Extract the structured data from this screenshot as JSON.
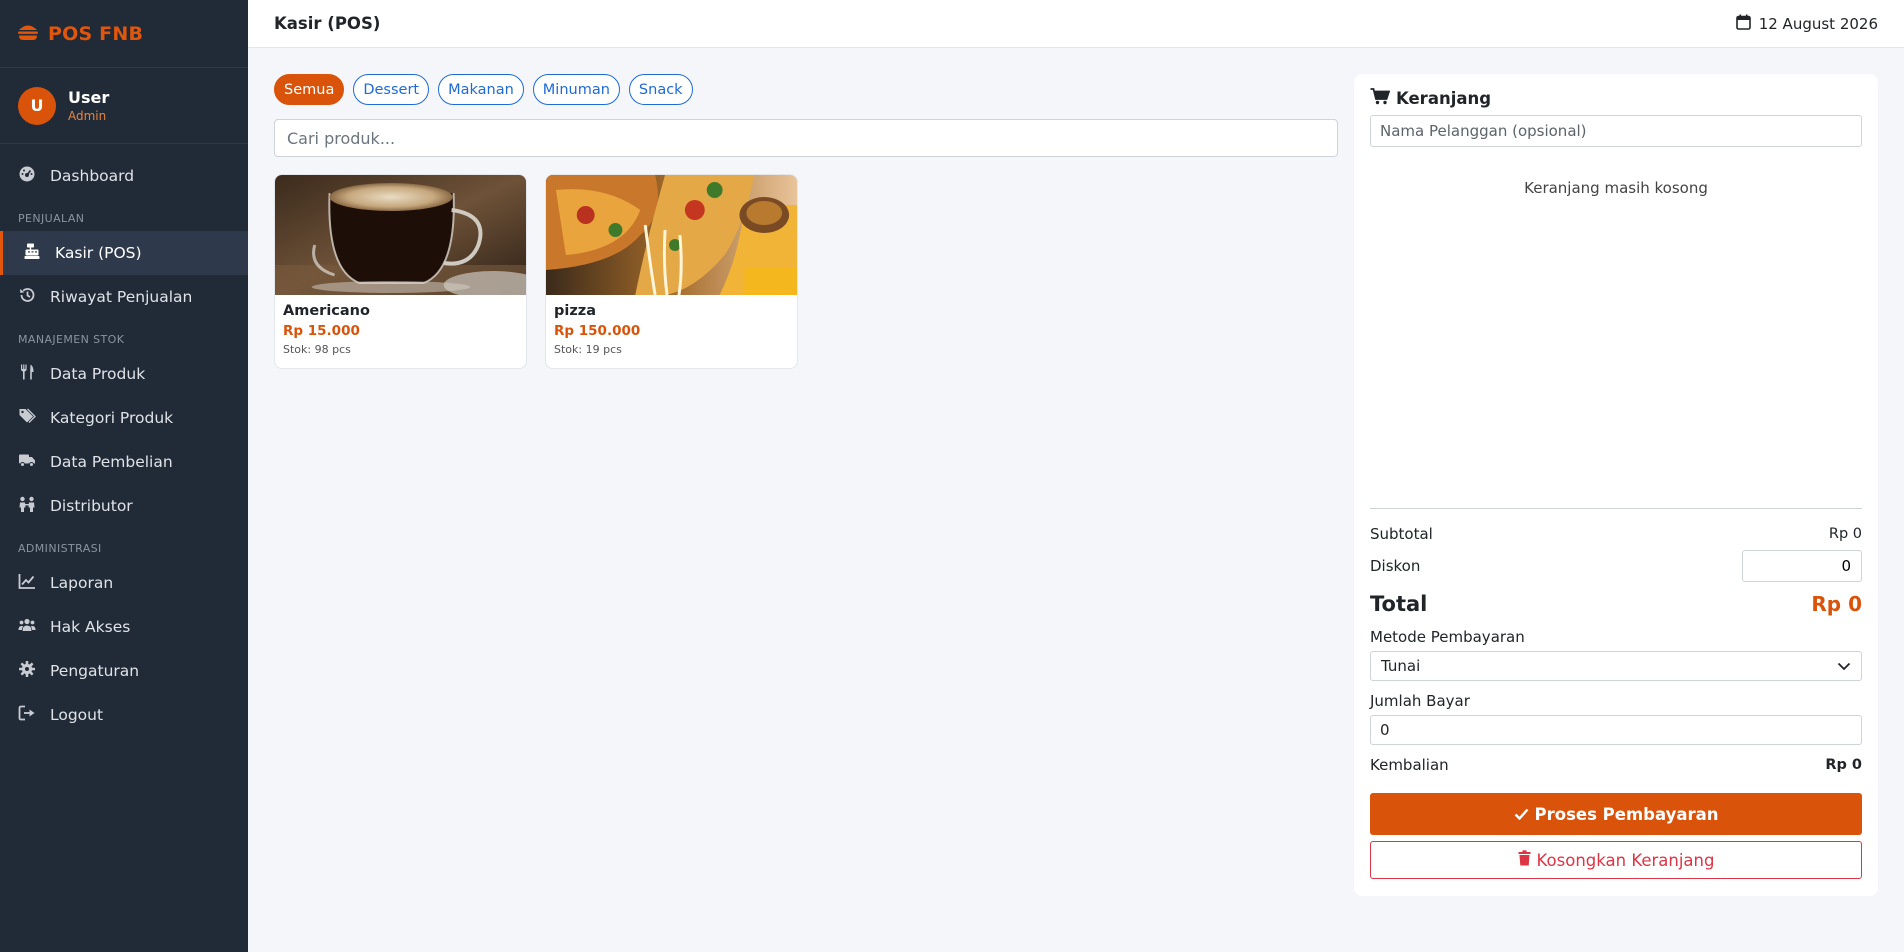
{
  "app": {
    "brand": "POS FNB",
    "brand_icon": "burger-icon",
    "accent": "#d9540a"
  },
  "user": {
    "initial": "U",
    "name": "User",
    "role": "Admin"
  },
  "sidebar": {
    "items": [
      {
        "label": "Dashboard",
        "icon": "dashboard-icon"
      },
      {
        "section": "PENJUALAN"
      },
      {
        "label": "Kasir (POS)",
        "icon": "cash-register-icon",
        "active": true
      },
      {
        "label": "Riwayat Penjualan",
        "icon": "history-icon"
      },
      {
        "section": "MANAJEMEN STOK"
      },
      {
        "label": "Data Produk",
        "icon": "utensils-icon"
      },
      {
        "label": "Kategori Produk",
        "icon": "tags-icon"
      },
      {
        "label": "Data Pembelian",
        "icon": "truck-icon"
      },
      {
        "label": "Distributor",
        "icon": "people-icon"
      },
      {
        "section": "ADMINISTRASI"
      },
      {
        "label": "Laporan",
        "icon": "chart-line-icon"
      },
      {
        "label": "Hak Akses",
        "icon": "users-icon"
      },
      {
        "label": "Pengaturan",
        "icon": "gear-icon"
      },
      {
        "label": "Logout",
        "icon": "logout-icon"
      }
    ]
  },
  "header": {
    "title": "Kasir (POS)",
    "date": "12 August 2026"
  },
  "categories": [
    "Semua",
    "Dessert",
    "Makanan",
    "Minuman",
    "Snack"
  ],
  "search": {
    "placeholder": "Cari produk..."
  },
  "products": [
    {
      "name": "Americano",
      "price": "Rp 15.000",
      "stock": "Stok: 98 pcs"
    },
    {
      "name": "pizza",
      "price": "Rp 150.000",
      "stock": "Stok: 19 pcs"
    }
  ],
  "cart": {
    "title": "Keranjang",
    "customer_placeholder": "Nama Pelanggan (opsional)",
    "empty_text": "Keranjang masih kosong",
    "subtotal_label": "Subtotal",
    "subtotal_value": "Rp 0",
    "discount_label": "Diskon",
    "discount_value": "0",
    "total_label": "Total",
    "total_value": "Rp 0",
    "payment_method_label": "Metode Pembayaran",
    "payment_method_value": "Tunai",
    "paid_label": "Jumlah Bayar",
    "paid_value": "0",
    "change_label": "Kembalian",
    "change_value": "Rp 0",
    "pay_button": "Proses Pembayaran",
    "clear_button": "Kosongkan Keranjang"
  }
}
